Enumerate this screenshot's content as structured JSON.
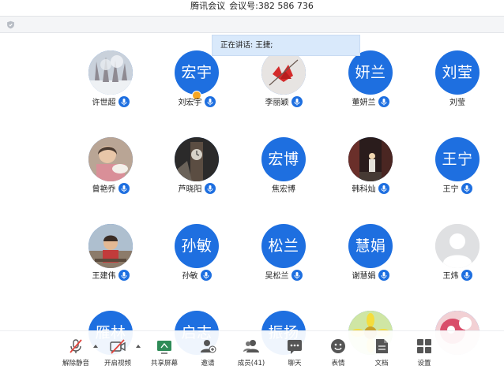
{
  "window": {
    "app_name": "腾讯会议",
    "meeting_id_label": "会议号:",
    "meeting_id": "382 586 736"
  },
  "speaking": {
    "label": "正在讲话:",
    "name": "王捷;"
  },
  "participants": [
    {
      "name": "许世超",
      "avatar": "photo-snow-trees",
      "mic": "mic-icon"
    },
    {
      "name": "刘宏宇",
      "avatar_text": "宏宇",
      "host": true,
      "mic": "mic-icon"
    },
    {
      "name": "李丽颖",
      "avatar": "photo-red-leaves",
      "mic": "mic-icon"
    },
    {
      "name": "董妍兰",
      "avatar_text": "妍兰",
      "mic": "mic-icon"
    },
    {
      "name": "刘莹",
      "avatar_text": "刘莹",
      "mic": ""
    },
    {
      "name": "曾艳乔",
      "avatar": "photo-child",
      "mic": "mic-icon"
    },
    {
      "name": "芦晓阳",
      "avatar": "photo-clock-tower",
      "mic": "mic-icon"
    },
    {
      "name": "焦宏博",
      "avatar_text": "宏博",
      "mic": ""
    },
    {
      "name": "韩科灿",
      "avatar": "photo-night-street",
      "mic": "mic-icon"
    },
    {
      "name": "王宁",
      "avatar_text": "王宁",
      "mic": "mic-icon"
    },
    {
      "name": "王建伟",
      "avatar": "photo-kid-outdoor",
      "mic": "mic-icon"
    },
    {
      "name": "孙敏",
      "avatar_text": "孙敏",
      "mic": "mic-icon"
    },
    {
      "name": "吴松兰",
      "avatar_text": "松兰",
      "mic": "mic-icon"
    },
    {
      "name": "谢慧娟",
      "avatar_text": "慧娟",
      "mic": "mic-icon"
    },
    {
      "name": "王炜",
      "avatar": "default-user",
      "mic": "mic-icon"
    },
    {
      "name": "",
      "avatar_text": "雁林",
      "mic": ""
    },
    {
      "name": "",
      "avatar_text": "启志",
      "mic": ""
    },
    {
      "name": "",
      "avatar_text": "振扬",
      "mic": ""
    },
    {
      "name": "",
      "avatar": "photo-flower",
      "mic": ""
    },
    {
      "name": "",
      "avatar": "photo-pink",
      "mic": ""
    }
  ],
  "toolbar": {
    "unmute": "解除静音",
    "start_video": "开启视频",
    "share_screen": "共享屏幕",
    "invite": "邀请",
    "members": "成员(41)",
    "chat": "聊天",
    "reactions": "表情",
    "docs": "文档",
    "settings": "设置"
  },
  "colors": {
    "accent": "#1e6fe0",
    "speaking_bg": "#d9e9fb",
    "muted_red": "#e0433b",
    "host_badge": "#f6a623"
  }
}
